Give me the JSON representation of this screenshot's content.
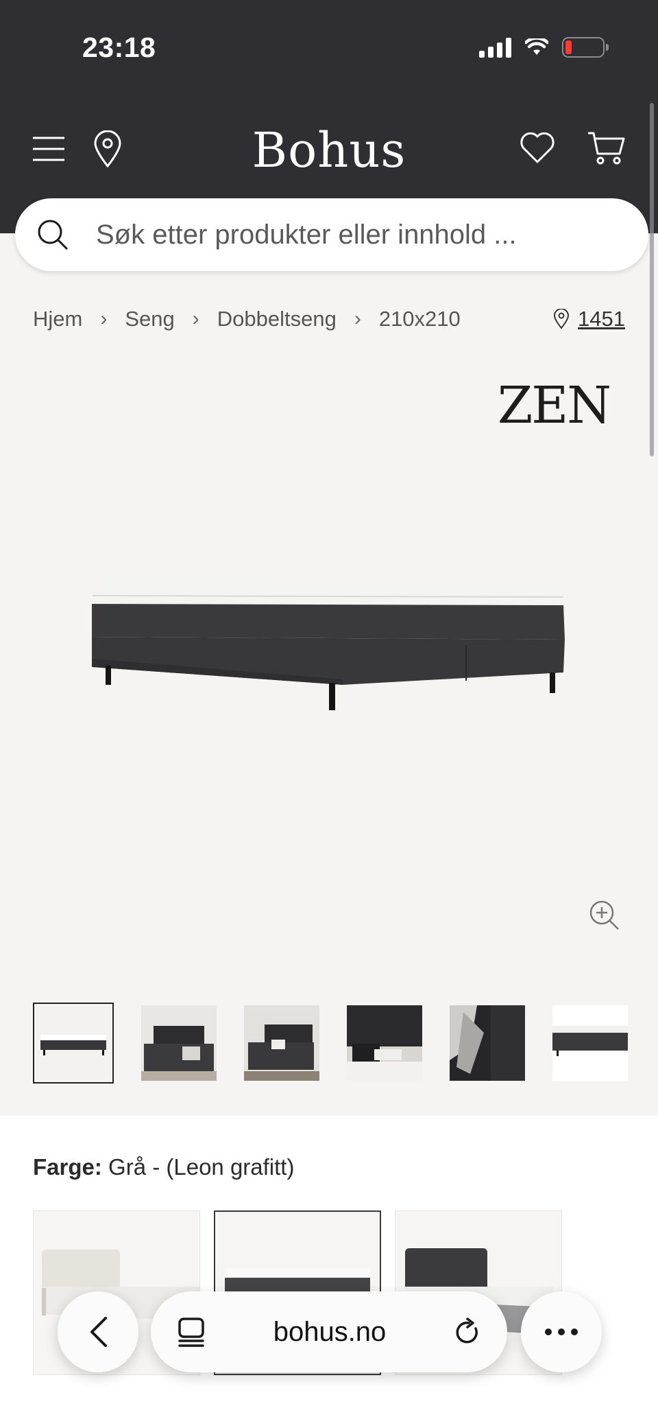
{
  "status_bar": {
    "time": "23:18"
  },
  "header": {
    "logo": "Bohus",
    "menu_icon": "hamburger-icon",
    "location_icon": "map-pin-icon",
    "wishlist_icon": "heart-icon",
    "cart_icon": "cart-icon"
  },
  "search": {
    "placeholder": "Søk etter produkter eller innhold ..."
  },
  "breadcrumb": {
    "items": [
      "Hjem",
      "Seng",
      "Dobbeltseng",
      "210x210"
    ],
    "store_number": "1451"
  },
  "product": {
    "brand": "ZEN",
    "image_alt": "Kontinentalseng grå"
  },
  "thumbnails": {
    "count_visible": 6,
    "active_index": 0
  },
  "variant": {
    "label": "Farge:",
    "value": "Grå - (Leon grafitt)",
    "swatch_colors": [
      "#e9e6e0",
      "#444446",
      "#3b3b3d"
    ],
    "active_index": 1
  },
  "browser": {
    "url": "bohus.no"
  },
  "colors": {
    "header_bg": "#2e2e33",
    "page_bg": "#f5f4f2",
    "battery_low": "#ff3b30"
  }
}
